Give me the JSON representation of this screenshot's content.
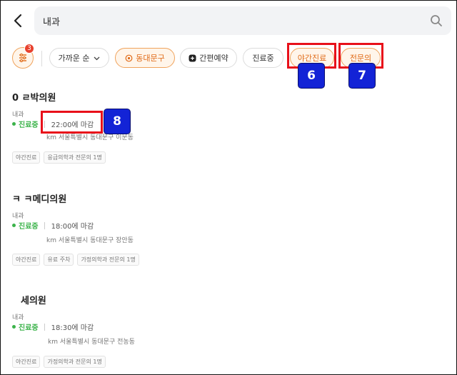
{
  "search": {
    "value": "내과"
  },
  "filters": {
    "badge_count": "3",
    "chips": [
      {
        "label": "가까운 순"
      },
      {
        "label": "동대문구"
      },
      {
        "label": "간편예약"
      },
      {
        "label": "진료중"
      },
      {
        "label": "야간진료"
      },
      {
        "label": "전문의"
      }
    ]
  },
  "annotations": [
    {
      "number": "6"
    },
    {
      "number": "7"
    },
    {
      "number": "8"
    }
  ],
  "colors": {
    "accent": "#e06a17",
    "open_status": "#3bb34a",
    "highlight": "#e8101a",
    "marker": "#1323d6"
  },
  "clinics": [
    {
      "name": "0 ㄹ박의원",
      "dept": "내과",
      "status": "진료중",
      "closing": "22:00에 마감",
      "address": "km 서울특별시 동대문구 이문동",
      "tags": [
        "야간진료",
        "응급의학과 전문의 1명"
      ]
    },
    {
      "name": "ㅋ ㅋ메디의원",
      "dept": "내과",
      "status": "진료중",
      "closing": "18:00에 마감",
      "address": "km 서울특별시 동대문구 장안동",
      "tags": [
        "야간진료",
        "유료 주차",
        "가정의학과 전문의 1명"
      ]
    },
    {
      "name": "세의원",
      "dept": "내과",
      "status": "진료중",
      "closing": "18:30에 마감",
      "address": "km 서울특별시 동대문구 전농동",
      "tags": [
        "야간진료",
        "가정의학과 전문의 1명"
      ]
    }
  ]
}
